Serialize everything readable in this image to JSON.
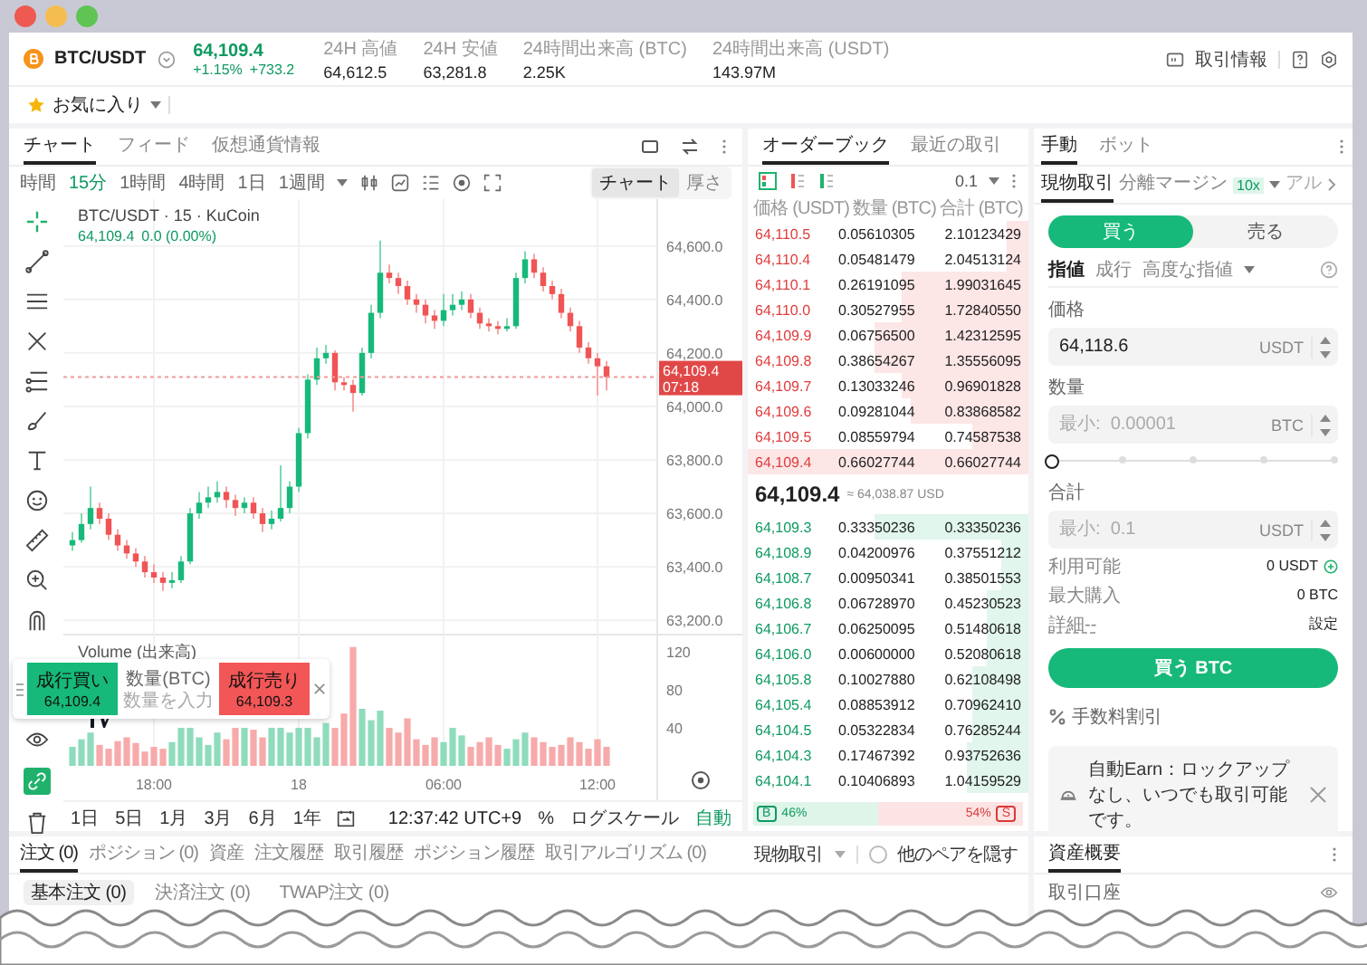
{
  "header": {
    "pair": "BTC/USDT",
    "price": "64,109.4",
    "change_percent": "+1.15%",
    "change_amount": "+733.2",
    "stats": [
      {
        "label": "24H 高値",
        "value": "64,612.5"
      },
      {
        "label": "24H 安値",
        "value": "63,281.8"
      },
      {
        "label": "24時間出来高 (BTC)",
        "value": "2.25K"
      },
      {
        "label": "24時間出来高 (USDT)",
        "value": "143.97M"
      }
    ],
    "trade_info": "取引情報",
    "favorites": "お気に入り"
  },
  "chart_panel": {
    "tabs": [
      {
        "label": "チャート",
        "selected": true
      },
      {
        "label": "フィード",
        "selected": false
      },
      {
        "label": "仮想通貨情報",
        "selected": false
      }
    ],
    "interval_label": "時間",
    "intervals": [
      {
        "label": "15分",
        "selected": true
      },
      {
        "label": "1時間",
        "selected": false
      },
      {
        "label": "4時間",
        "selected": false
      },
      {
        "label": "1日",
        "selected": false
      },
      {
        "label": "1週間",
        "selected": false
      }
    ],
    "view_modes": [
      {
        "label": "チャート",
        "selected": true
      },
      {
        "label": "厚さ",
        "selected": false
      }
    ],
    "legend": {
      "title": "BTC/USDT · 15 · KuCoin",
      "price": "64,109.4",
      "change": "0.0 (0.00%)"
    },
    "price_chart": {
      "chart_data": {
        "type": "candlestick",
        "grid": true,
        "ylim": [
          63150,
          64775
        ],
        "categories": [
          null,
          null,
          null,
          null,
          null,
          null,
          null,
          null,
          null,
          null,
          null,
          null,
          null,
          null,
          null,
          null,
          null,
          null,
          null,
          null,
          null,
          null,
          null,
          null,
          null,
          null,
          null,
          null,
          null,
          null,
          null,
          null,
          null,
          null,
          null,
          null,
          null,
          null,
          null,
          null,
          null,
          null,
          null,
          null,
          null,
          null,
          null,
          null,
          null,
          null,
          null,
          null,
          null,
          null,
          null,
          null,
          null,
          null,
          null,
          null
        ],
        "ohlc": [
          [
            63480,
            63530,
            63460,
            63500
          ],
          [
            63500,
            63600,
            63490,
            63560
          ],
          [
            63560,
            63700,
            63540,
            63620
          ],
          [
            63620,
            63640,
            63560,
            63580
          ],
          [
            63580,
            63600,
            63500,
            63520
          ],
          [
            63520,
            63540,
            63460,
            63480
          ],
          [
            63480,
            63500,
            63430,
            63450
          ],
          [
            63450,
            63470,
            63400,
            63420
          ],
          [
            63420,
            63440,
            63360,
            63380
          ],
          [
            63380,
            63410,
            63340,
            63360
          ],
          [
            63360,
            63380,
            63310,
            63340
          ],
          [
            63340,
            63380,
            63320,
            63350
          ],
          [
            63350,
            63440,
            63340,
            63420
          ],
          [
            63420,
            63620,
            63410,
            63600
          ],
          [
            63600,
            63680,
            63580,
            63640
          ],
          [
            63640,
            63700,
            63620,
            63660
          ],
          [
            63660,
            63720,
            63640,
            63680
          ],
          [
            63680,
            63700,
            63620,
            63650
          ],
          [
            63650,
            63670,
            63590,
            63620
          ],
          [
            63620,
            63660,
            63600,
            63640
          ],
          [
            63640,
            63660,
            63580,
            63600
          ],
          [
            63600,
            63620,
            63530,
            63560
          ],
          [
            63560,
            63610,
            63540,
            63580
          ],
          [
            63580,
            63780,
            63570,
            63620
          ],
          [
            63620,
            63720,
            63600,
            63700
          ],
          [
            63700,
            63920,
            63680,
            63900
          ],
          [
            63900,
            64120,
            63880,
            64100
          ],
          [
            64100,
            64220,
            64080,
            64180
          ],
          [
            64180,
            64230,
            64160,
            64200
          ],
          [
            64200,
            64210,
            64060,
            64090
          ],
          [
            64090,
            64110,
            64060,
            64080
          ],
          [
            64080,
            64100,
            63980,
            64050
          ],
          [
            64050,
            64220,
            64040,
            64200
          ],
          [
            64200,
            64380,
            64180,
            64350
          ],
          [
            64350,
            64620,
            64330,
            64500
          ],
          [
            64500,
            64530,
            64460,
            64480
          ],
          [
            64480,
            64500,
            64420,
            64450
          ],
          [
            64450,
            64470,
            64380,
            64400
          ],
          [
            64400,
            64420,
            64350,
            64380
          ],
          [
            64380,
            64400,
            64310,
            64340
          ],
          [
            64340,
            64360,
            64290,
            64320
          ],
          [
            64320,
            64420,
            64300,
            64360
          ],
          [
            64360,
            64420,
            64340,
            64380
          ],
          [
            64380,
            64430,
            64360,
            64400
          ],
          [
            64400,
            64420,
            64330,
            64350
          ],
          [
            64350,
            64370,
            64290,
            64310
          ],
          [
            64310,
            64330,
            64280,
            64300
          ],
          [
            64300,
            64320,
            64270,
            64290
          ],
          [
            64290,
            64330,
            64280,
            64300
          ],
          [
            64300,
            64500,
            64290,
            64480
          ],
          [
            64480,
            64580,
            64460,
            64550
          ],
          [
            64550,
            64570,
            64480,
            64500
          ],
          [
            64500,
            64520,
            64430,
            64450
          ],
          [
            64450,
            64470,
            64400,
            64420
          ],
          [
            64420,
            64440,
            64330,
            64350
          ],
          [
            64350,
            64370,
            64280,
            64300
          ],
          [
            64300,
            64320,
            64200,
            64220
          ],
          [
            64220,
            64240,
            64160,
            64180
          ],
          [
            64180,
            64200,
            64040,
            64150
          ],
          [
            64150,
            64170,
            64060,
            64110
          ]
        ],
        "yticks": [
          {
            "value": 64600,
            "label": "64,600.0"
          },
          {
            "value": 64400,
            "label": "64,400.0"
          },
          {
            "value": 64200,
            "label": "64,200.0"
          },
          {
            "value": 64000,
            "label": "64,000.0"
          },
          {
            "value": 63800,
            "label": "63,800.0"
          },
          {
            "value": 63600,
            "label": "63,600.0"
          },
          {
            "value": 63400,
            "label": "63,400.0"
          },
          {
            "value": 63200,
            "label": "63,200.0"
          }
        ],
        "ref_lines": [
          {
            "axis": "y",
            "value": 64109.4,
            "label": "64,109.4"
          }
        ]
      },
      "countdown": "07:18"
    },
    "volume_chart": {
      "label": "Volume (出来高)",
      "chart_data": {
        "type": "bar",
        "grid": true,
        "ylim": [
          0,
          139
        ],
        "categories": [
          null,
          null,
          null,
          null,
          null,
          null,
          null,
          null,
          null,
          "18:00",
          null,
          null,
          null,
          null,
          null,
          null,
          null,
          null,
          null,
          null,
          null,
          null,
          null,
          null,
          null,
          "18",
          null,
          null,
          null,
          null,
          null,
          null,
          null,
          null,
          null,
          null,
          null,
          null,
          null,
          null,
          null,
          "06:00",
          null,
          null,
          null,
          null,
          null,
          null,
          null,
          null,
          null,
          null,
          null,
          null,
          null,
          null,
          null,
          null,
          "12:00",
          null
        ],
        "values": [
          20,
          28,
          35,
          22,
          18,
          26,
          30,
          24,
          15,
          20,
          18,
          25,
          40,
          40,
          30,
          22,
          35,
          28,
          40,
          40,
          38,
          30,
          40,
          40,
          35,
          40,
          40,
          30,
          45,
          40,
          55,
          125,
          60,
          48,
          58,
          40,
          35,
          50,
          28,
          22,
          30,
          25,
          40,
          32,
          20,
          25,
          30,
          22,
          18,
          28,
          35,
          30,
          25,
          20,
          22,
          30,
          25,
          18,
          28,
          20
        ],
        "yticks": [
          {
            "value": 40,
            "label": "40"
          },
          {
            "value": 80,
            "label": "80"
          },
          {
            "value": 120,
            "label": "120"
          }
        ]
      }
    },
    "quick_trade": {
      "buy_label": "成行買い",
      "buy_price": "64,109.4",
      "quantity_label": "数量(BTC)",
      "quantity_placeholder": "数量を入力",
      "sell_label": "成行売り",
      "sell_price": "64,109.3"
    },
    "ranges": [
      "1日",
      "5日",
      "1月",
      "3月",
      "6月",
      "1年"
    ],
    "clock": "12:37:42 UTC+9",
    "percent": "%",
    "log_scale": "ログスケール",
    "auto": "自動"
  },
  "orderbook": {
    "tabs": [
      {
        "label": "オーダーブック",
        "selected": true
      },
      {
        "label": "最近の取引",
        "selected": false
      }
    ],
    "precision": "0.1",
    "columns": [
      "価格 (USDT)",
      "数量 (BTC)",
      "合計 (BTC)"
    ],
    "asks": [
      {
        "price": "64,110.5",
        "amount": "0.05610305",
        "total": "2.10123429",
        "level": 0.08
      },
      {
        "price": "64,110.4",
        "amount": "0.05481479",
        "total": "2.04513124",
        "level": 0.08
      },
      {
        "price": "64,110.1",
        "amount": "0.26191095",
        "total": "1.99031645",
        "level": 0.45
      },
      {
        "price": "64,110.0",
        "amount": "0.30527955",
        "total": "1.72840550",
        "level": 0.45
      },
      {
        "price": "64,109.9",
        "amount": "0.06756500",
        "total": "1.42312595",
        "level": 0.55
      },
      {
        "price": "64,109.8",
        "amount": "0.38654267",
        "total": "1.35556095",
        "level": 0.55
      },
      {
        "price": "64,109.7",
        "amount": "0.13033246",
        "total": "0.96901828",
        "level": 0.45
      },
      {
        "price": "64,109.6",
        "amount": "0.09281044",
        "total": "0.83868582",
        "level": 0.42
      },
      {
        "price": "64,109.5",
        "amount": "0.08559794",
        "total": "0.74587538",
        "level": 0.2
      },
      {
        "price": "64,109.4",
        "amount": "0.66027744",
        "total": "0.66027744",
        "level": 1.0
      }
    ],
    "mid_price": "64,109.4",
    "mid_usd": "≈ 64,038.87 USD",
    "bids": [
      {
        "price": "64,109.3",
        "amount": "0.33350236",
        "total": "0.33350236",
        "level": 0.55
      },
      {
        "price": "64,108.9",
        "amount": "0.04200976",
        "total": "0.37551212",
        "level": 0.1
      },
      {
        "price": "64,108.7",
        "amount": "0.00950341",
        "total": "0.38501553",
        "level": 0.1
      },
      {
        "price": "64,106.8",
        "amount": "0.06728970",
        "total": "0.45230523",
        "level": 0.15
      },
      {
        "price": "64,106.7",
        "amount": "0.06250095",
        "total": "0.51480618",
        "level": 0.15
      },
      {
        "price": "64,106.0",
        "amount": "0.00600000",
        "total": "0.52080618",
        "level": 0.15
      },
      {
        "price": "64,105.8",
        "amount": "0.10027880",
        "total": "0.62108498",
        "level": 0.2
      },
      {
        "price": "64,105.4",
        "amount": "0.08853912",
        "total": "0.70962410",
        "level": 0.2
      },
      {
        "price": "64,104.5",
        "amount": "0.05322834",
        "total": "0.76285244",
        "level": 0.2
      },
      {
        "price": "64,104.3",
        "amount": "0.17467392",
        "total": "0.93752636",
        "level": 0.22
      },
      {
        "price": "64,104.1",
        "amount": "0.10406893",
        "total": "1.04159529",
        "level": 0.22
      }
    ],
    "ratio": {
      "buy_badge": "B",
      "buy": "46%",
      "sell": "54%",
      "sell_badge": "S",
      "level": 0.46
    }
  },
  "trade_panel": {
    "tabs": [
      {
        "label": "手動",
        "selected": true
      },
      {
        "label": "ボット",
        "selected": false
      }
    ],
    "modes": [
      {
        "label": "現物取引",
        "selected": true
      },
      {
        "label": "分離マージン",
        "selected": false
      }
    ],
    "leverage": "10x",
    "more_mode": "アル",
    "sides": [
      {
        "label": "買う",
        "selected": true
      },
      {
        "label": "売る",
        "selected": false
      }
    ],
    "order_types": [
      {
        "label": "指値",
        "selected": true
      },
      {
        "label": "成行",
        "selected": false
      },
      {
        "label": "高度な指値",
        "selected": false
      }
    ],
    "fields": [
      {
        "label": "価格",
        "value": "64,118.6",
        "unit": "USDT"
      },
      {
        "label": "数量",
        "placeholder": "最小:  0.00001",
        "unit": "BTC"
      },
      {
        "label": "合計",
        "placeholder": "最小:  0.1",
        "unit": "USDT"
      }
    ],
    "slider": {
      "level": 0
    },
    "info": [
      {
        "label": "利用可能",
        "value": "0 USDT"
      },
      {
        "label": "最大購入",
        "value": "0 BTC"
      },
      {
        "label": "詳細--",
        "value": "設定"
      }
    ],
    "submit": "買う BTC",
    "fee_discount": "手数料割引",
    "notice": "自動Earn：ロックアップなし、いつでも取引可能です。"
  },
  "orders_panel": {
    "tabs": [
      {
        "label": "注文 (0)",
        "selected": true
      },
      {
        "label": "ポジション (0)",
        "selected": false
      },
      {
        "label": "資産",
        "selected": false
      },
      {
        "label": "注文履歴",
        "selected": false
      },
      {
        "label": "取引履歴",
        "selected": false
      },
      {
        "label": "ポジション履歴",
        "selected": false
      },
      {
        "label": "取引アルゴリズム (0)",
        "selected": false
      }
    ],
    "market_filter": "現物取引",
    "hide_other_pairs": {
      "label": "他のペアを隠す",
      "checked": false
    },
    "subtabs": [
      {
        "label": "基本注文 (0)",
        "selected": true
      },
      {
        "label": "決済注文 (0)",
        "selected": false
      },
      {
        "label": "TWAP注文 (0)",
        "selected": false
      }
    ]
  },
  "assets_panel": {
    "title": "資産概要",
    "account": "取引口座"
  }
}
